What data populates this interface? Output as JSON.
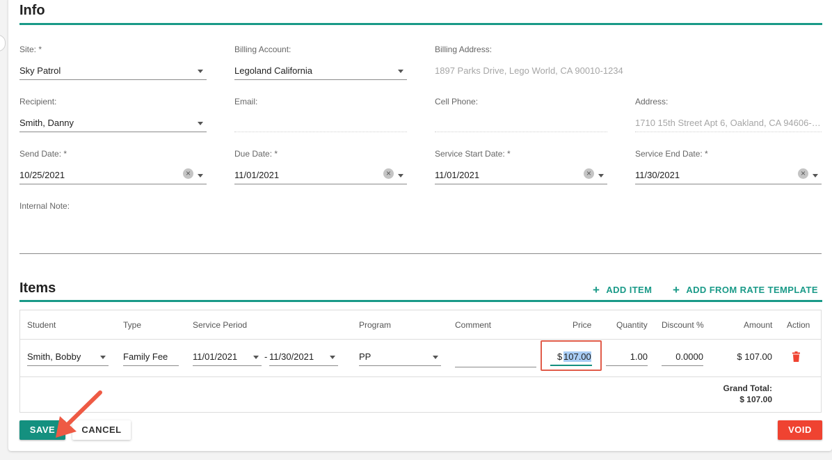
{
  "info": {
    "title": "Info",
    "site": {
      "label": "Site: *",
      "value": "Sky Patrol"
    },
    "billing_account": {
      "label": "Billing Account:",
      "value": "Legoland California"
    },
    "billing_address": {
      "label": "Billing Address:",
      "value": "1897 Parks Drive, Lego World, CA 90010-1234"
    },
    "recipient": {
      "label": "Recipient:",
      "value": "Smith, Danny"
    },
    "email": {
      "label": "Email:",
      "value": ""
    },
    "cell_phone": {
      "label": "Cell Phone:",
      "value": ""
    },
    "address": {
      "label": "Address:",
      "value": "1710 15th Street Apt 6, Oakland, CA 94606-3..."
    },
    "send_date": {
      "label": "Send Date: *",
      "value": "10/25/2021"
    },
    "due_date": {
      "label": "Due Date: *",
      "value": "11/01/2021"
    },
    "service_start": {
      "label": "Service Start Date: *",
      "value": "11/01/2021"
    },
    "service_end": {
      "label": "Service End Date: *",
      "value": "11/30/2021"
    },
    "internal_note": {
      "label": "Internal Note:",
      "value": ""
    }
  },
  "items": {
    "title": "Items",
    "add_item_label": "ADD ITEM",
    "add_from_rate_label": "ADD FROM RATE TEMPLATE",
    "columns": {
      "student": "Student",
      "type": "Type",
      "service_period": "Service Period",
      "program": "Program",
      "comment": "Comment",
      "price": "Price",
      "quantity": "Quantity",
      "discount": "Discount %",
      "amount": "Amount",
      "action": "Action"
    },
    "row": {
      "student": "Smith, Bobby",
      "type": "Family Fee",
      "period_start": "11/01/2021",
      "period_separator": "-",
      "period_end": "11/30/2021",
      "program": "PP",
      "comment": "",
      "price_prefix": "$",
      "price": "107.00",
      "quantity": "1.00",
      "discount": "0.0000",
      "amount": "$ 107.00"
    },
    "grand_total_label": "Grand Total:",
    "grand_total_value": "$ 107.00"
  },
  "buttons": {
    "save": "SAVE",
    "cancel": "CANCEL",
    "void": "VOID"
  },
  "colors": {
    "accent": "#1a9a88",
    "danger": "#ef4331",
    "highlight_box": "#e15c4a",
    "annotation_arrow": "#ee5a44"
  }
}
